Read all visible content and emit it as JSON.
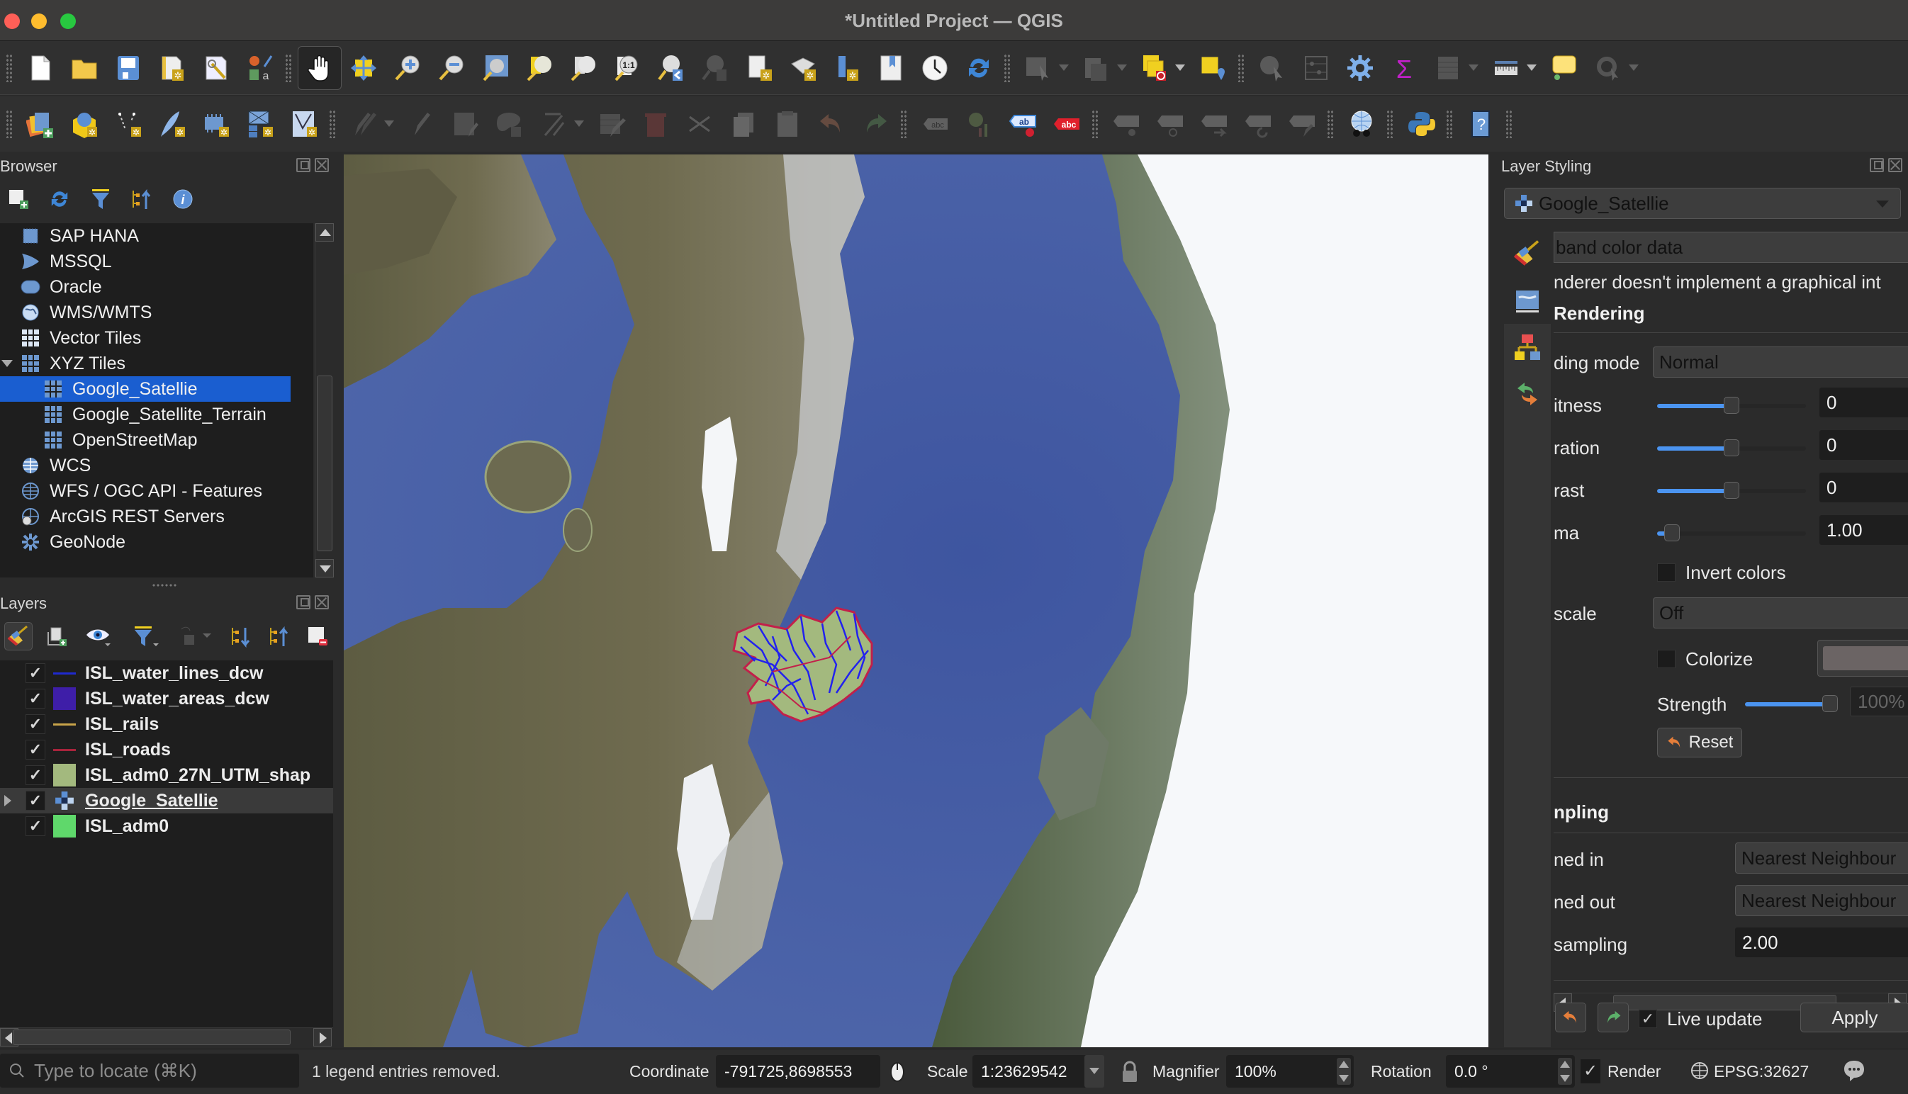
{
  "window": {
    "title": "*Untitled Project — QGIS"
  },
  "toolbar_row1": [
    "new-project",
    "open-project",
    "save-project",
    "new-print-layout",
    "layout-manager",
    "style-manager",
    "pan-map",
    "pan-to-selection",
    "zoom-in",
    "zoom-out",
    "zoom-full",
    "zoom-to-selection",
    "zoom-to-layer",
    "zoom-native-resolution",
    "zoom-last",
    "zoom-next",
    "new-spatial-bookmark",
    "show-spatial-bookmarks",
    "new-3d-map-view",
    "new-map-view",
    "temporal-controller",
    "refresh",
    "select-features",
    "select-by-attribute",
    "deselect-all",
    "select-by-location",
    "identify-features",
    "attribute-table-stats",
    "toolbox-settings",
    "field-calculator",
    "open-attribute-table",
    "measure-line",
    "map-tips",
    "run-feature-action"
  ],
  "toolbar_row2": [
    "data-source-manager",
    "new-geopackage-layer",
    "new-shapefile-layer",
    "new-spatialite-layer",
    "new-virtual-layer",
    "new-mesh-layer",
    "new-temporary-scratch-layer",
    "current-edits",
    "toggle-editing",
    "save-layer-edits",
    "digitize-polygon",
    "vertex-tool",
    "modify-attributes",
    "delete-selected",
    "cut-features",
    "copy-features",
    "paste-features",
    "undo",
    "redo",
    "label-toolbar",
    "diagram-options",
    "layer-labeling-options",
    "highlight-pinned-labels",
    "pin-unpin-labels",
    "show-hide-labels",
    "move-label",
    "rotate-label",
    "change-label",
    "metasearch",
    "python-console",
    "help-contents"
  ],
  "browser": {
    "title": "Browser",
    "items": [
      {
        "label": "SAP HANA",
        "icon": "sap-hana-icon",
        "indent": 1
      },
      {
        "label": "MSSQL",
        "icon": "mssql-icon",
        "indent": 1
      },
      {
        "label": "Oracle",
        "icon": "oracle-icon",
        "indent": 1
      },
      {
        "label": "WMS/WMTS",
        "icon": "wms-globe-icon",
        "indent": 1
      },
      {
        "label": "Vector Tiles",
        "icon": "vector-tiles-icon",
        "indent": 1
      },
      {
        "label": "XYZ Tiles",
        "icon": "xyz-tiles-icon",
        "indent": 1,
        "expanded": true
      },
      {
        "label": "Google_Satellie",
        "icon": "xyz-tile-icon",
        "indent": 2,
        "selected": true
      },
      {
        "label": "Google_Satellite_Terrain",
        "icon": "xyz-tile-icon",
        "indent": 2
      },
      {
        "label": "OpenStreetMap",
        "icon": "xyz-tile-icon",
        "indent": 2
      },
      {
        "label": "WCS",
        "icon": "wcs-globe-icon",
        "indent": 1
      },
      {
        "label": "WFS / OGC API - Features",
        "icon": "wfs-globe-icon",
        "indent": 1
      },
      {
        "label": "ArcGIS REST Servers",
        "icon": "arcgis-globe-icon",
        "indent": 1
      },
      {
        "label": "GeoNode",
        "icon": "geonode-icon",
        "indent": 1
      }
    ]
  },
  "layers": {
    "title": "Layers",
    "items": [
      {
        "name": "ISL_water_lines_dcw",
        "visible": true,
        "symbol": "line",
        "color": "#1f2ad0"
      },
      {
        "name": "ISL_water_areas_dcw",
        "visible": true,
        "symbol": "fill",
        "color": "#3e1ea8"
      },
      {
        "name": "ISL_rails",
        "visible": true,
        "symbol": "line",
        "color": "#c9a44a"
      },
      {
        "name": "ISL_roads",
        "visible": true,
        "symbol": "line",
        "color": "#a8243c"
      },
      {
        "name": "ISL_adm0_27N_UTM_shap",
        "visible": true,
        "symbol": "fill",
        "color": "#a3b97e"
      },
      {
        "name": "Google_Satellie",
        "visible": true,
        "symbol": "raster",
        "current": true,
        "expandable": true
      },
      {
        "name": "ISL_adm0",
        "visible": true,
        "symbol": "fill",
        "color": "#5fd86b"
      }
    ]
  },
  "layer_styling": {
    "title": "Layer Styling",
    "layer": "Google_Satellie",
    "renderer": "band color data",
    "renderer_info": "nderer doesn't implement a graphical int",
    "rendering_section": "Rendering",
    "blending_mode_label": "ding mode",
    "blending_mode": "Normal",
    "brightness_label": "itness",
    "brightness": "0",
    "brightness_fraction": 0.5,
    "saturation_label": "ration",
    "saturation": "0",
    "saturation_fraction": 0.5,
    "contrast_label": "rast",
    "contrast": "0",
    "contrast_fraction": 0.5,
    "gamma_label": "ma",
    "gamma": "1.00",
    "gamma_fraction": 0.1,
    "invert_colors_label": "Invert colors",
    "invert_colors": false,
    "grayscale_label": "scale",
    "grayscale": "Off",
    "colorize_label": "Colorize",
    "colorize": false,
    "colorize_color": "#6b6464",
    "strength_label": "Strength",
    "strength": "100%",
    "strength_fraction": 1.0,
    "reset_label": "Reset",
    "resampling_section": "npling",
    "zoomed_in_label": "ned in",
    "zoomed_in": "Nearest Neighbour",
    "zoomed_out_label": "ned out",
    "zoomed_out": "Nearest Neighbour",
    "oversampling_label": "sampling",
    "oversampling": "2.00",
    "live_update_label": "Live update",
    "live_update": true,
    "apply_label": "Apply"
  },
  "statusbar": {
    "locator_placeholder": "Type to locate (⌘K)",
    "message": "1 legend entries removed.",
    "coordinate_label": "Coordinate",
    "coordinate": "-791725,8698553",
    "scale_label": "Scale",
    "scale": "1:23629542",
    "magnifier_label": "Magnifier",
    "magnifier": "100%",
    "rotation_label": "Rotation",
    "rotation": "0.0 °",
    "render_label": "Render",
    "render": true,
    "crs": "EPSG:32627"
  },
  "map": {
    "basemap": "Google_Satellie",
    "colors": {
      "ocean": "#4b63a5",
      "land": "#6b6a4e",
      "ice": "#f6f8fa",
      "iceland_fill": "#a3b97e",
      "rivers": "#2222ee",
      "roads": "#c2204a"
    }
  }
}
